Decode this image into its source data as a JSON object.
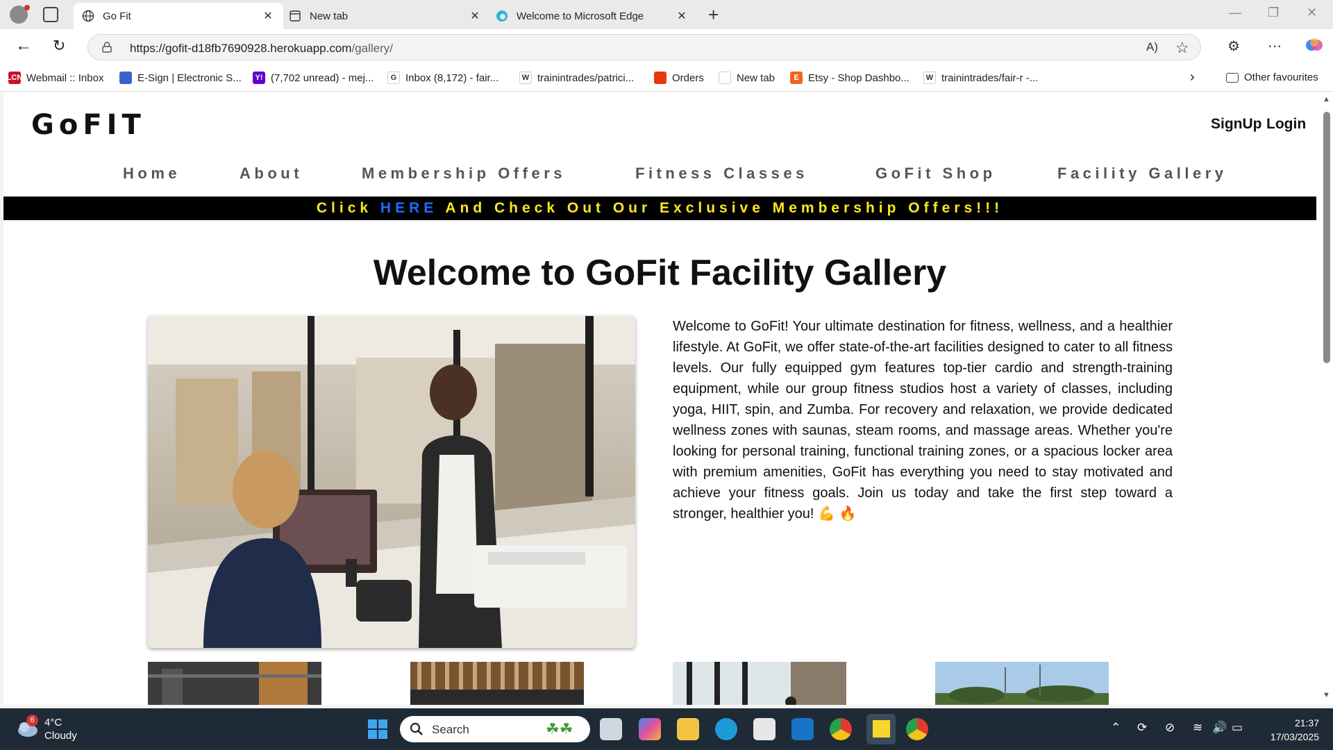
{
  "browser": {
    "tabs": [
      {
        "label": "Go Fit",
        "icon": "globe-icon",
        "active": true
      },
      {
        "label": "New tab",
        "icon": "newtab-icon",
        "active": false
      },
      {
        "label": "Welcome to Microsoft Edge",
        "icon": "edge-icon",
        "active": false
      }
    ],
    "url_host": "https://gofit-d18fb7690928.herokuapp.com",
    "url_path": "/gallery/",
    "bookmarks": [
      {
        "label": "Webmail :: Inbox",
        "color": "#c4142c",
        "icon": "webmail-icon",
        "glyph": "LCN"
      },
      {
        "label": "E-Sign | Electronic S...",
        "color": "#3a63c9",
        "icon": "esign-icon",
        "glyph": ""
      },
      {
        "label": "(7,702 unread) - mej...",
        "color": "#6001d2",
        "icon": "yahoo-icon",
        "glyph": "Y!"
      },
      {
        "label": "Inbox (8,172) - fair...",
        "color": "#ffffff",
        "icon": "google-icon",
        "glyph": "G"
      },
      {
        "label": "trainintrades/patrici...",
        "color": "#ffffff",
        "icon": "w-icon",
        "glyph": "W"
      },
      {
        "label": "Orders",
        "color": "#e8380d",
        "icon": "orders-icon",
        "glyph": ""
      },
      {
        "label": "New tab",
        "color": "#ffffff",
        "icon": "newtab-icon",
        "glyph": ""
      },
      {
        "label": "Etsy - Shop Dashbo...",
        "color": "#f1641e",
        "icon": "etsy-icon",
        "glyph": "E"
      },
      {
        "label": "trainintrades/fair-r -...",
        "color": "#ffffff",
        "icon": "w-icon",
        "glyph": "W"
      }
    ],
    "other_favourites": "Other favourites"
  },
  "site": {
    "logo": "GoFIT",
    "signup": "SignUp",
    "login": "Login",
    "nav": [
      "Home",
      "About",
      "Membership Offers",
      "Fitness Classes",
      "GoFit Shop",
      "Facility Gallery"
    ],
    "promo_before": "Click ",
    "promo_link": "HERE",
    "promo_after": " And Check Out Our Exclusive Membership Offers!!!",
    "promo_color": "#ffe81f",
    "promo_link_color": "#1e6cff",
    "title": "Welcome to GoFit Facility Gallery",
    "intro": "Welcome to GoFit! Your ultimate destination for fitness, wellness, and a healthier lifestyle. At GoFit, we offer state-of-the-art facilities designed to cater to all fitness levels. Our fully equipped gym features top-tier cardio and strength-training equipment, while our group fitness studios host a variety of classes, including yoga, HIIT, spin, and Zumba. For recovery and relaxation, we provide dedicated wellness zones with saunas, steam rooms, and massage areas. Whether you're looking for personal training, functional training zones, or a spacious locker area with premium amenities, GoFit has everything you need to stay motivated and achieve your fitness goals. Join us today and take the first step toward a stronger, healthier you! 💪 🔥"
  },
  "taskbar": {
    "weather_temp": "4°C",
    "weather_cond": "Cloudy",
    "weather_badge": "6",
    "search": "Search",
    "time": "21:37",
    "date": "17/03/2025"
  }
}
